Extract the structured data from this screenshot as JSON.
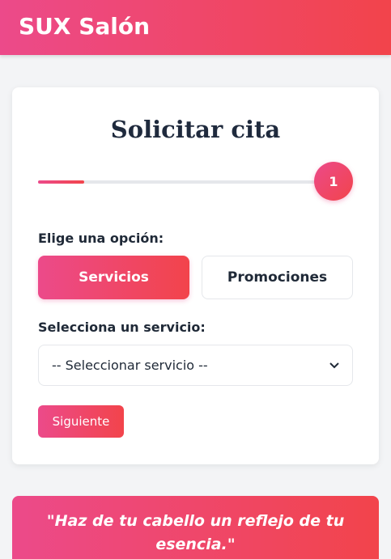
{
  "header": {
    "brand": "SUX Salón"
  },
  "form": {
    "title": "Solicitar cita",
    "progress_fraction": 0.156,
    "step_number": "1",
    "option_label": "Elige una opción:",
    "options": [
      {
        "label": "Servicios",
        "selected": true
      },
      {
        "label": "Promociones",
        "selected": false
      }
    ],
    "service_label": "Selecciona un servicio:",
    "service_select_value": "-- Seleccionar servicio --",
    "next_label": "Siguiente"
  },
  "quote": {
    "text": "\"Haz de tu cabello un reflejo de tu esencia.\""
  },
  "colors": {
    "accent_start": "#ec4a8a",
    "accent_end": "#f2444b",
    "background": "#f3f4f6"
  },
  "icons": {
    "select_arrow": "chevron-down-icon"
  }
}
